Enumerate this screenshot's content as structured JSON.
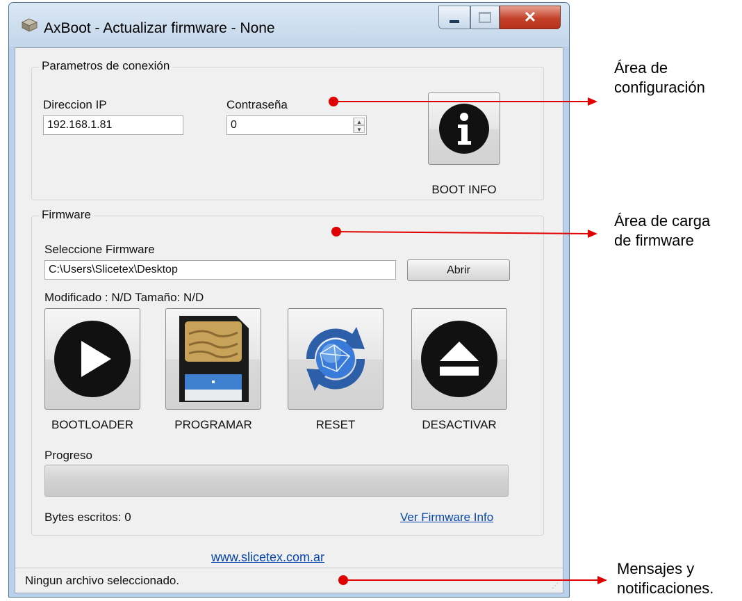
{
  "window": {
    "title": "AxBoot - Actualizar firmware - None",
    "icon": "drive-icon"
  },
  "conexion": {
    "legend": "Parametros de conexión",
    "ip_label": "Direccion IP",
    "ip_value": "192.168.1.81",
    "password_label": "Contraseña",
    "password_value": "0",
    "boot_info_label": "BOOT INFO"
  },
  "firmware": {
    "legend": "Firmware",
    "select_label": "Seleccione Firmware",
    "path_value": "C:\\Users\\Slicetex\\Desktop",
    "open_button": "Abrir",
    "modified_info": "Modificado : N/D Tamaño: N/D",
    "actions": [
      {
        "label": "BOOTLOADER",
        "icon": "play-icon"
      },
      {
        "label": "PROGRAMAR",
        "icon": "sd-card-icon"
      },
      {
        "label": "RESET",
        "icon": "globe-refresh-icon"
      },
      {
        "label": "DESACTIVAR",
        "icon": "eject-icon"
      }
    ],
    "progress_label": "Progreso",
    "progress": 0,
    "bytes_written": "Bytes escritos: 0",
    "fw_info_link": "Ver Firmware Info"
  },
  "website_link": "www.slicetex.com.ar",
  "status": "Ningun archivo seleccionado.",
  "annotations": {
    "config": [
      "Área de",
      "configuración"
    ],
    "carga": [
      "Área de carga",
      "de firmware"
    ],
    "mensajes": [
      "Mensajes y",
      "notificaciones."
    ]
  },
  "colors": {
    "annotation_arrow": "#e00000",
    "link": "#0645ad"
  }
}
